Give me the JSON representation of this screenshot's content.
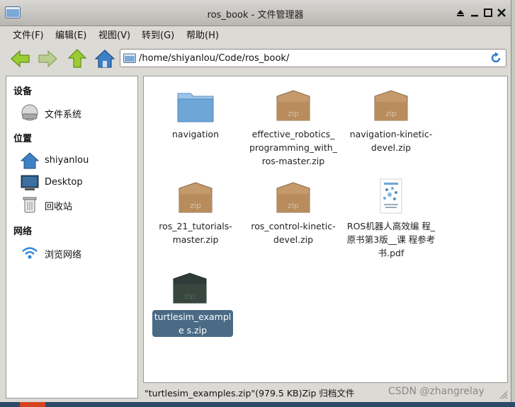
{
  "window": {
    "title": "ros_book - 文件管理器"
  },
  "menu": [
    "文件(F)",
    "编辑(E)",
    "视图(V)",
    "转到(G)",
    "帮助(H)"
  ],
  "location": {
    "path": "/home/shiyanlou/Code/ros_book/"
  },
  "sidebar": {
    "devices_heading": "设备",
    "devices": [
      {
        "label": "文件系统",
        "icon": "drive-icon"
      }
    ],
    "places_heading": "位置",
    "places": [
      {
        "label": "shiyanlou",
        "icon": "home-icon"
      },
      {
        "label": "Desktop",
        "icon": "desktop-icon"
      },
      {
        "label": "回收站",
        "icon": "trash-icon"
      }
    ],
    "network_heading": "网络",
    "network": [
      {
        "label": "浏览网络",
        "icon": "wifi-icon"
      }
    ]
  },
  "files": [
    {
      "name": "navigation",
      "type": "folder"
    },
    {
      "name": "effective_robotics_ programming_with_ ros-master.zip",
      "type": "zip"
    },
    {
      "name": "navigation-kinetic- devel.zip",
      "type": "zip"
    },
    {
      "name": "ros_21_tutorials- master.zip",
      "type": "zip"
    },
    {
      "name": "ros_control-kinetic- devel.zip",
      "type": "zip"
    },
    {
      "name": "ROS机器人高效编 程_原书第3版__课 程参考书.pdf",
      "type": "pdf"
    },
    {
      "name": "turtlesim_example s.zip",
      "type": "zip",
      "selected": true
    }
  ],
  "zip_label": "zip",
  "status": "\"turtlesim_examples.zip\"(979.5 KB)Zip 归档文件",
  "watermark": "CSDN @zhangrelay",
  "colors": {
    "selection": "#4a6a86",
    "folder": "#6fa6d8",
    "zip_box": "#c49a6c"
  }
}
